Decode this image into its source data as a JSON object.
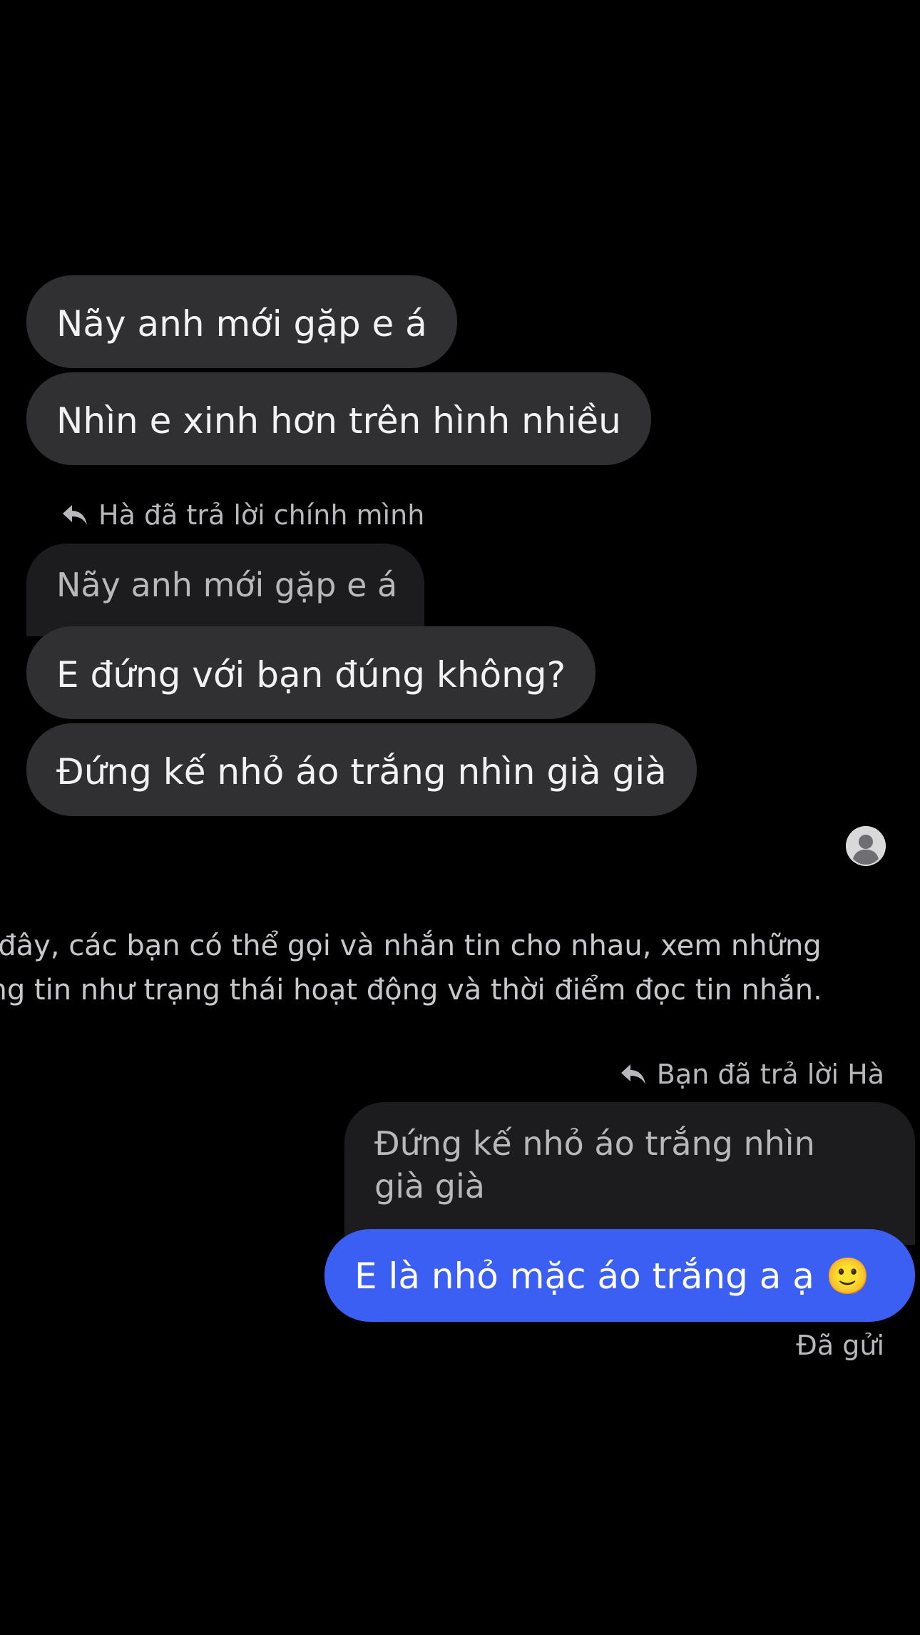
{
  "thread": {
    "received_1": "Nãy anh mới gặp e á",
    "received_2": "Nhìn e xinh hơn trên hình nhiều",
    "reply_label_received": "Hà đã trả lời chính mình",
    "reply_quoted_received": "Nãy anh mới gặp e á",
    "received_3": "E đứng với bạn đúng không?",
    "received_4": "Đứng kế nhỏ áo trắng nhìn già già",
    "system_notice_line1": "ở đây, các bạn có thể gọi và nhắn tin cho nhau, xem những",
    "system_notice_line2": "ông tin như trạng thái hoạt động và thời điểm đọc tin nhắn.",
    "reply_label_sent": "Bạn đã trả lời Hà",
    "reply_quoted_sent_line1": "Đứng kế nhỏ áo trắng nhìn",
    "reply_quoted_sent_line2": "già già",
    "sent_1": "E là nhỏ mặc áo trắng a ạ 🙂",
    "sent_status": "Đã gửi"
  },
  "colors": {
    "background": "#000000",
    "received_bubble": "#303032",
    "quoted_bubble": "#1c1c1e",
    "sent_bubble": "#3b5ff3",
    "secondary_text": "#b8b8bc"
  },
  "icons": {
    "reply": "reply-arrow-icon",
    "avatar": "default-avatar-icon"
  }
}
